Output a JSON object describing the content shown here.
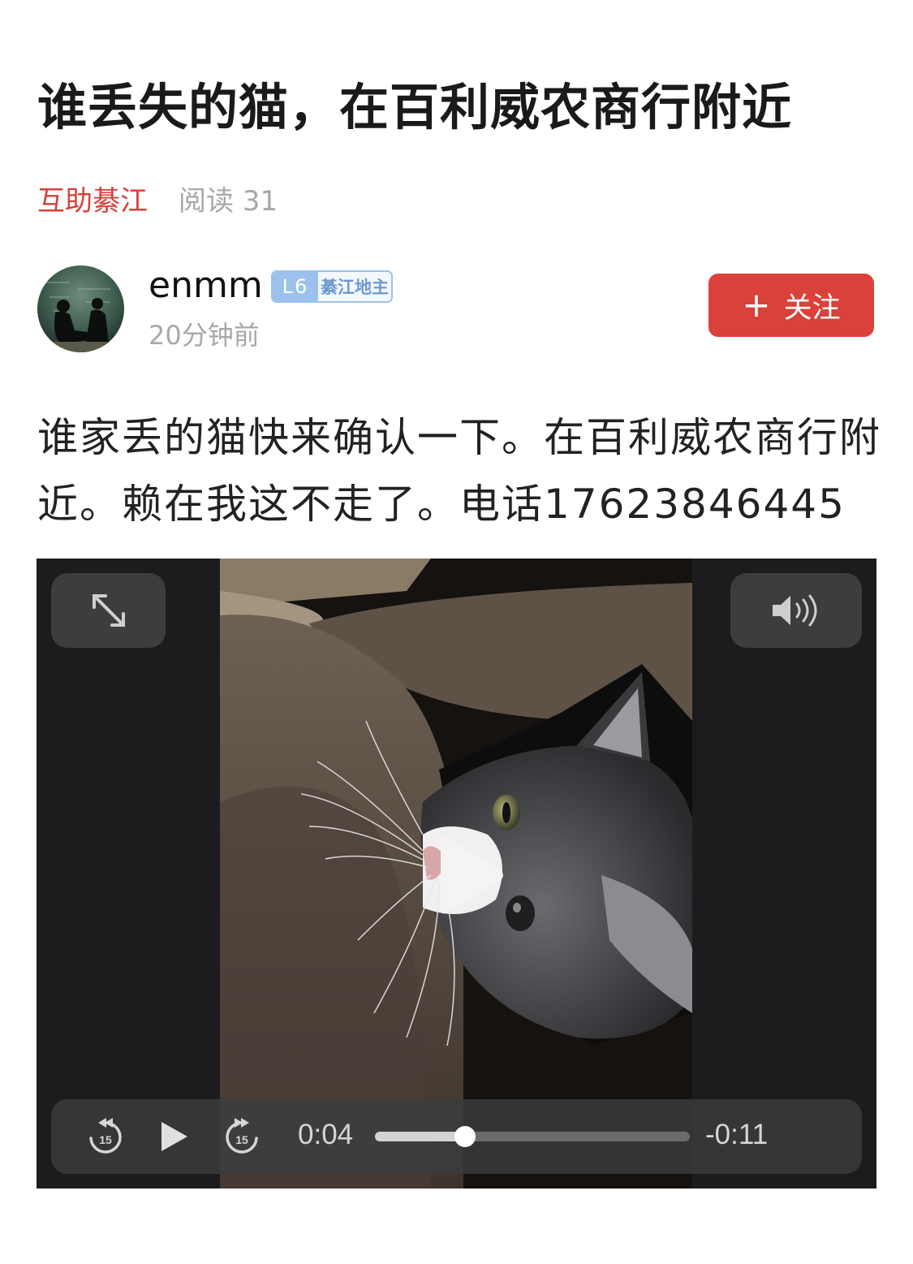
{
  "post": {
    "title": "谁丢失的猫，在百利威农商行附近",
    "channel": "互助綦江",
    "reads": "阅读 31",
    "body": "谁家丢的猫快来确认一下。在百利威农商行附近。赖在我这不走了。电话17623846445"
  },
  "author": {
    "name": "enmm",
    "level": "L6",
    "level_title": "綦江地主",
    "time_ago": "20分钟前",
    "follow_label": "关注"
  },
  "video": {
    "current_time": "0:04",
    "remaining_time": "-0:11",
    "progress": 0.285,
    "skip_seconds": "15"
  },
  "colors": {
    "accent": "#d9413a",
    "badge": "#9cc1ec"
  },
  "icons": {
    "fullscreen": "expand-arrows-icon",
    "volume": "speaker-icon",
    "play": "play-icon",
    "skip_back": "skip-back-15-icon",
    "skip_forward": "skip-forward-15-icon"
  }
}
